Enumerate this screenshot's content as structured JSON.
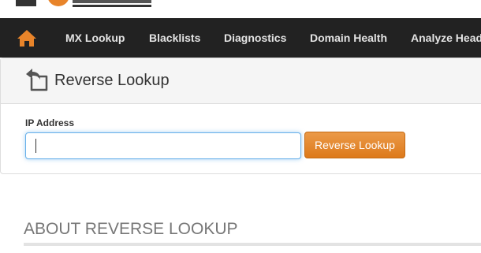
{
  "nav": {
    "items": [
      {
        "label": "MX Lookup"
      },
      {
        "label": "Blacklists"
      },
      {
        "label": "Diagnostics"
      },
      {
        "label": "Domain Health"
      },
      {
        "label": "Analyze Headers"
      }
    ],
    "home_icon": "home-icon"
  },
  "tool": {
    "title": "Reverse Lookup",
    "icon": "reply-arrow-icon",
    "field_label": "IP Address",
    "input_value": "",
    "button_label": "Reverse Lookup"
  },
  "about": {
    "heading": "ABOUT REVERSE LOOKUP"
  },
  "colors": {
    "nav_background": "#222222",
    "accent_orange": "#e0821f",
    "panel_heading_bg": "#f5f5f5",
    "input_focus_border": "#66afe9"
  }
}
